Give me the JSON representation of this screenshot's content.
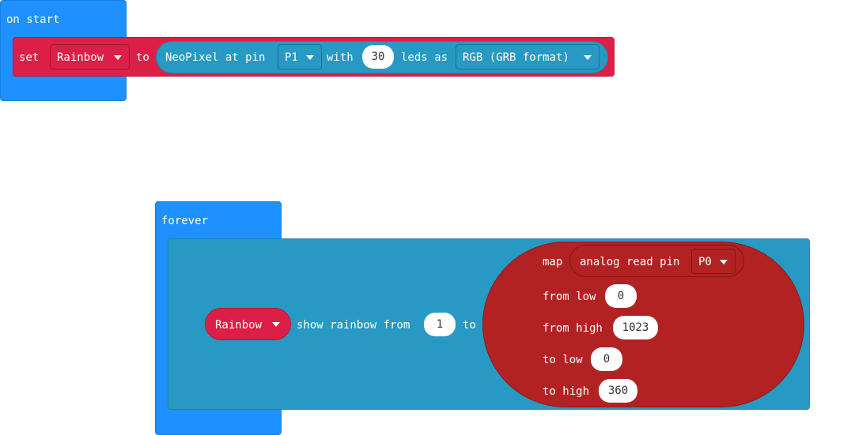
{
  "on_start": {
    "hat_label": "on start",
    "set_label": "set",
    "variable": "Rainbow",
    "to_label": "to",
    "neopixel": {
      "label": "NeoPixel at pin",
      "pin": "P1",
      "with_label": "with",
      "leds": "30",
      "leds_as_label": "leds as",
      "mode": "RGB (GRB format)"
    }
  },
  "forever": {
    "hat_label": "forever",
    "strip_variable": "Rainbow",
    "show_rainbow_label": "show rainbow from",
    "from_value": "1",
    "to_label": "to",
    "map": {
      "label": "map",
      "analog_label": "analog read pin",
      "pin": "P0",
      "from_low_label": "from low",
      "from_low": "0",
      "from_high_label": "from high",
      "from_high": "1023",
      "to_low_label": "to low",
      "to_low": "0",
      "to_high_label": "to high",
      "to_high": "360"
    }
  },
  "colors": {
    "events": "#1e90ff",
    "neopixel": "#2799c2",
    "variables": "#dc1f46",
    "math": "#b22222"
  }
}
